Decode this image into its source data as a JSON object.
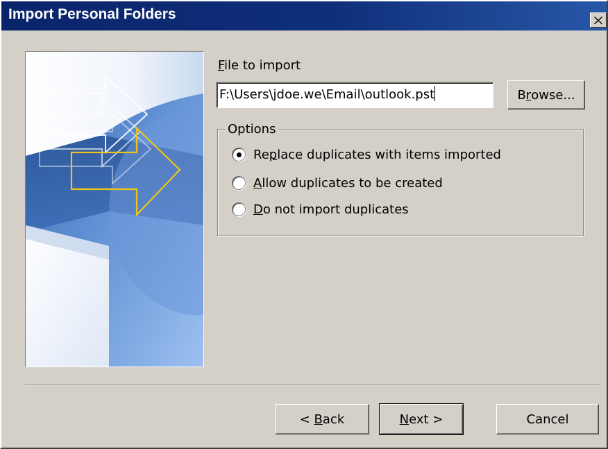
{
  "window": {
    "title": "Import Personal Folders"
  },
  "file_import": {
    "label_accel": "F",
    "label_rest": "ile to import",
    "value": "F:\\Users\\jdoe.we\\Email\\outlook.pst",
    "browse_pre": "B",
    "browse_accel": "r",
    "browse_post": "owse..."
  },
  "options": {
    "legend": "Options",
    "items": [
      {
        "pre": "Re",
        "accel": "p",
        "post": "lace duplicates with items imported",
        "selected": true
      },
      {
        "pre": "",
        "accel": "A",
        "post": "llow duplicates to be created",
        "selected": false
      },
      {
        "pre": "",
        "accel": "D",
        "post": "o not import duplicates",
        "selected": false
      }
    ]
  },
  "buttons": {
    "back_pre": "< ",
    "back_accel": "B",
    "back_post": "ack",
    "next_accel": "N",
    "next_post": "ext >",
    "cancel": "Cancel"
  },
  "colors": {
    "titlebar": "#0a246a",
    "face": "#d4d0c8",
    "arrow_yellow": "#f0c419"
  },
  "icons": {
    "close": "close-icon"
  }
}
